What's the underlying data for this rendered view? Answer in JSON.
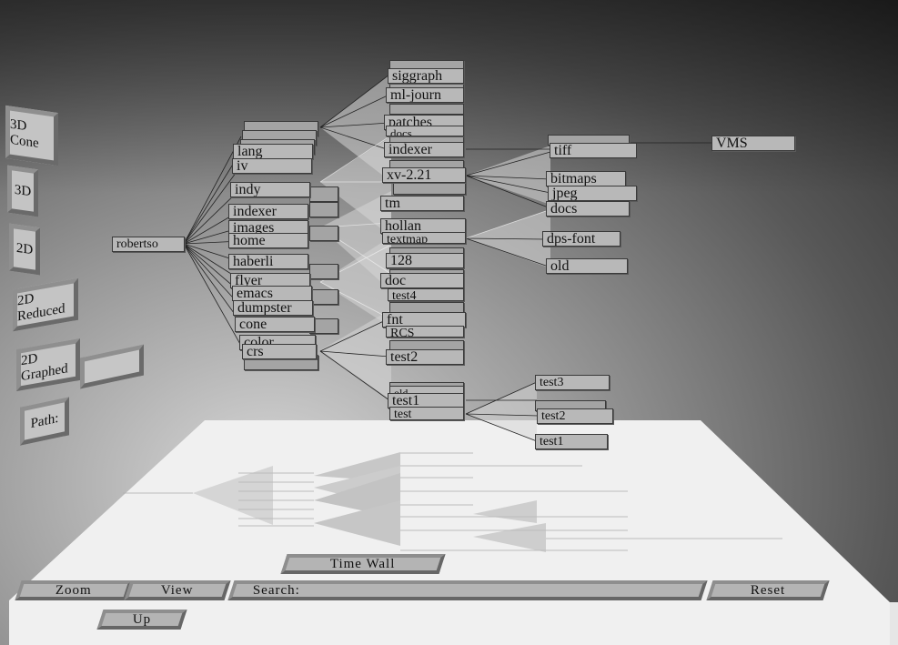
{
  "window": {
    "title": ""
  },
  "wall_buttons": {
    "cone_3d": "3D Cone",
    "view_3d": "3D",
    "view_2d": "2D",
    "reduced_2d": "2D Reduced",
    "graphed_2d": "2D Graphed",
    "path_label": "Path:",
    "path_value": ""
  },
  "floor_buttons": {
    "time_wall": "Time Wall",
    "zoom": "Zoom",
    "view": "View",
    "search_label": "Search:",
    "reset": "Reset",
    "up": "Up"
  },
  "tree": {
    "root": "robertso",
    "level1": [
      "lang",
      "iv",
      "indy",
      "indexer",
      "images",
      "home",
      "haberli",
      "flyer",
      "emacs",
      "dumpster",
      "cone",
      "color",
      "crs"
    ],
    "level2": [
      "siggraph",
      "ml-journ",
      "patches",
      "docs",
      "indexer",
      "xv-2.21",
      "tm",
      "hollan",
      "textmap",
      "128",
      "doc",
      "test4",
      "fnt",
      "RCS",
      "test2",
      "old",
      "test1",
      "test"
    ],
    "level3": [
      "tiff",
      "bitmaps",
      "jpeg",
      "docs",
      "dps-font",
      "old"
    ],
    "level4": [
      "VMS"
    ],
    "test_children": [
      "test3",
      "test2",
      "test1"
    ]
  },
  "colors": {
    "node_fill": "#b8b8b8",
    "floor": "#f2f2f2",
    "wall_dark": "#2e2e2e"
  }
}
